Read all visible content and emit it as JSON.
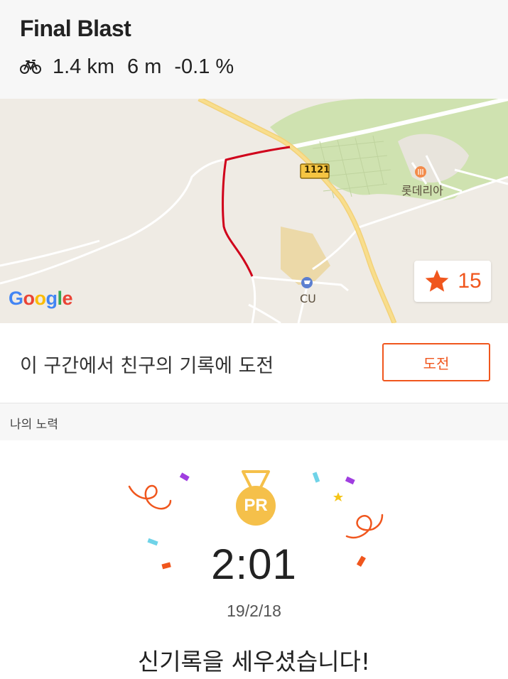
{
  "segment": {
    "title": "Final Blast",
    "activity_icon": "bike-icon",
    "distance": "1.4 km",
    "elevation": "6 m",
    "grade": "-0.1 %"
  },
  "map": {
    "road_shield": "1121",
    "poi_restaurant": "롯데리아",
    "poi_store": "CU",
    "attribution": "Google",
    "star_count": "15",
    "route_color": "#d0021b"
  },
  "challenge": {
    "text": "이 구간에서 친구의 기록에 도전",
    "button_label": "도전"
  },
  "section": {
    "label": "나의 노력"
  },
  "effort": {
    "badge": "PR",
    "time": "2:01",
    "date": "19/2/18",
    "message": "신기록을 세우셨습니다!"
  },
  "colors": {
    "accent": "#f0561d",
    "medal": "#f5c04a"
  }
}
